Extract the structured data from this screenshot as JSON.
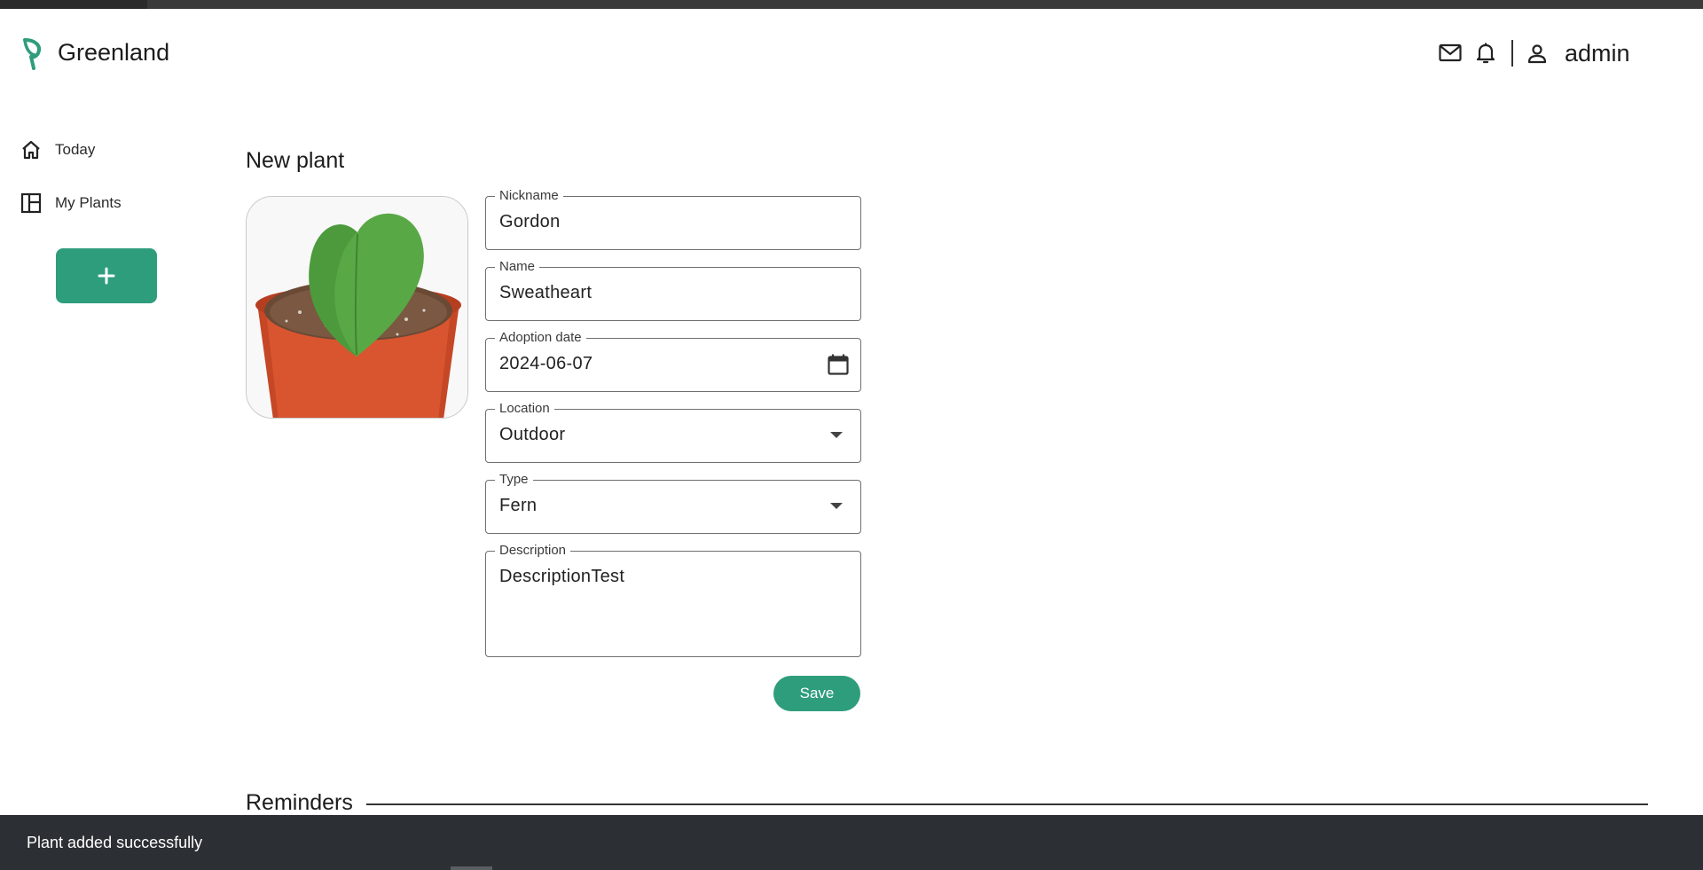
{
  "header": {
    "brand": "Greenland",
    "icons": [
      "leaf-logo-icon",
      "mail-icon",
      "bell-icon",
      "user-icon"
    ],
    "user_name": "admin"
  },
  "sidebar": {
    "items": [
      {
        "label": "Today",
        "icon": "home-icon"
      },
      {
        "label": "My Plants",
        "icon": "dashboard-icon"
      }
    ],
    "add_label": "+"
  },
  "form": {
    "title": "New plant",
    "fields": {
      "nickname": {
        "label": "Nickname",
        "value": "Gordon"
      },
      "name": {
        "label": "Name",
        "value": "Sweatheart"
      },
      "adoption_date": {
        "label": "Adoption date",
        "value": "2024-06-07"
      },
      "location": {
        "label": "Location",
        "value": "Outdoor"
      },
      "type": {
        "label": "Type",
        "value": "Fern"
      },
      "description": {
        "label": "Description",
        "value": "DescriptionTest"
      }
    },
    "save_label": "Save"
  },
  "reminders": {
    "title": "Reminders"
  },
  "snackbar": {
    "message": "Plant added successfully"
  },
  "colors": {
    "accent": "#2e9d7c",
    "snackbar": "#2c3034",
    "text": "#1c1c1c"
  }
}
